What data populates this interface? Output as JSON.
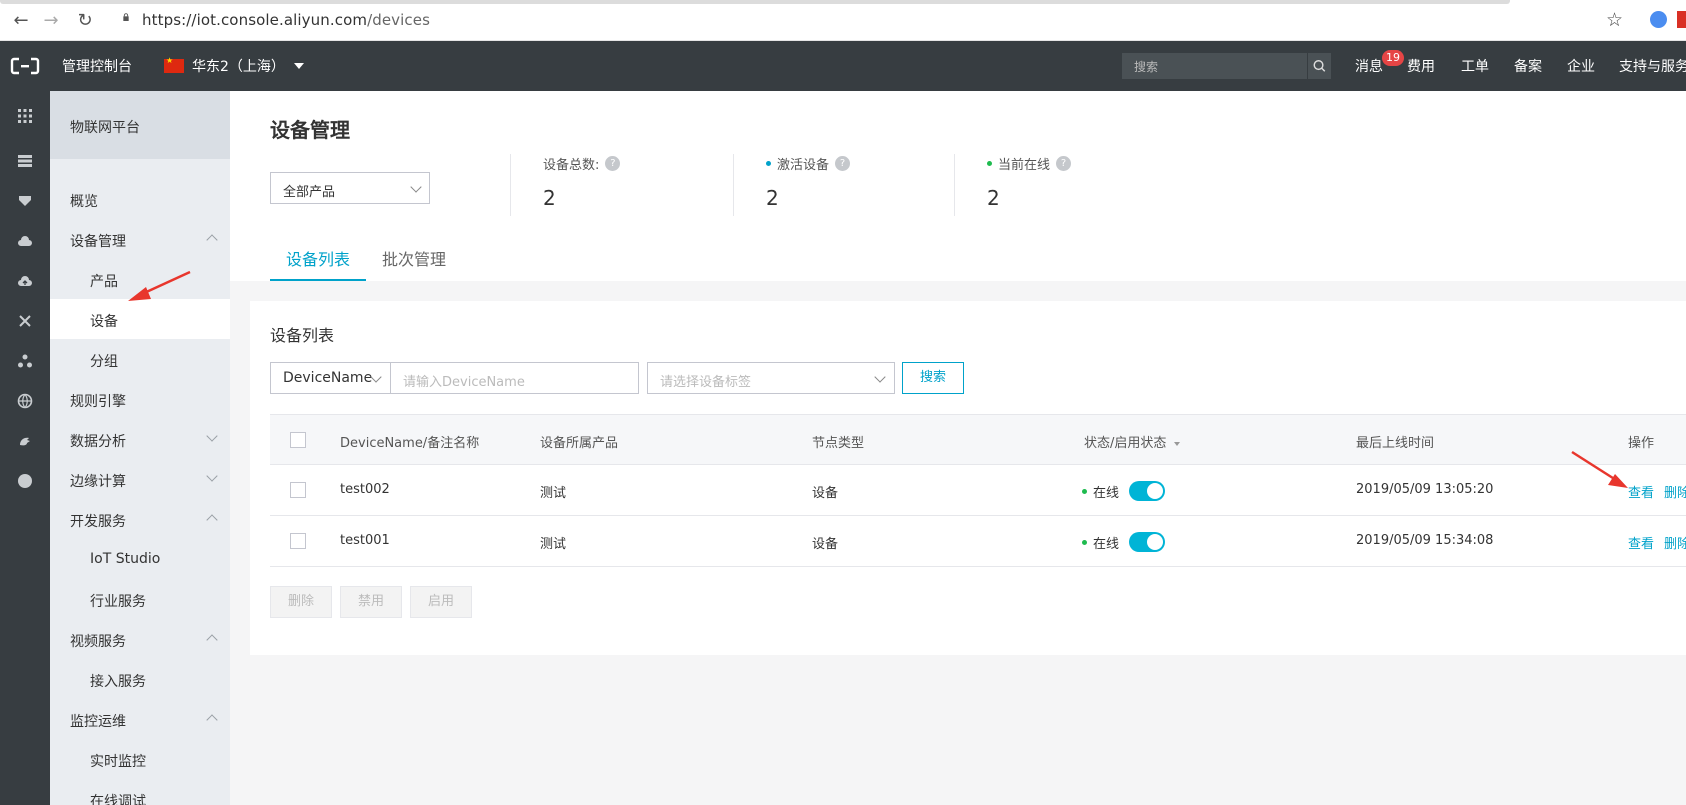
{
  "browser": {
    "url_base": "https://iot.console.aliyun.com",
    "url_path": "/devices"
  },
  "topnav": {
    "console_label": "管理控制台",
    "region": "华东2（上海）",
    "search_placeholder": "搜索",
    "links": [
      "消息",
      "费用",
      "工单",
      "备案",
      "企业",
      "支持与服务"
    ],
    "message_badge": "19"
  },
  "rail_icons": [
    "grid-icon",
    "storage-icon",
    "shield-icon",
    "cloud-icon",
    "cloud-up-icon",
    "network-icon",
    "cluster-icon",
    "globe-icon",
    "dragon-icon",
    "circle-icon"
  ],
  "sidebar": {
    "header": "物联网平台",
    "items": [
      {
        "label": "概览",
        "level": 0
      },
      {
        "label": "设备管理",
        "level": 0,
        "chevron": "up"
      },
      {
        "label": "产品",
        "level": 1
      },
      {
        "label": "设备",
        "level": 1,
        "active": true
      },
      {
        "label": "分组",
        "level": 1
      },
      {
        "label": "规则引擎",
        "level": 0
      },
      {
        "label": "数据分析",
        "level": 0,
        "chevron": "down"
      },
      {
        "label": "边缘计算",
        "level": 0,
        "chevron": "down"
      },
      {
        "label": "开发服务",
        "level": 0,
        "chevron": "up"
      },
      {
        "label": "IoT Studio",
        "level": 1
      },
      {
        "label": "行业服务",
        "level": 1
      },
      {
        "label": "视频服务",
        "level": 0,
        "chevron": "up"
      },
      {
        "label": "接入服务",
        "level": 1
      },
      {
        "label": "监控运维",
        "level": 0,
        "chevron": "up"
      },
      {
        "label": "实时监控",
        "level": 1
      },
      {
        "label": "在线调试",
        "level": 1
      }
    ]
  },
  "main": {
    "title": "设备管理",
    "product_select": "全部产品",
    "stats": {
      "total_label": "设备总数:",
      "total_value": "2",
      "active_label": "激活设备",
      "active_value": "2",
      "online_label": "当前在线",
      "online_value": "2"
    },
    "tabs": [
      "设备列表",
      "批次管理"
    ],
    "active_tab": 0
  },
  "device_list": {
    "title": "设备列表",
    "filter_select": "DeviceName",
    "filter_input_placeholder": "请输入DeviceName",
    "tag_select_placeholder": "请选择设备标签",
    "search_button": "搜索",
    "columns": [
      "DeviceName/备注名称",
      "设备所属产品",
      "节点类型",
      "状态/启用状态",
      "最后上线时间",
      "操作"
    ],
    "rows": [
      {
        "name": "test002",
        "product": "测试",
        "node_type": "设备",
        "status": "在线",
        "enabled": true,
        "last_online": "2019/05/09 13:05:20",
        "view": "查看",
        "delete": "删除"
      },
      {
        "name": "test001",
        "product": "测试",
        "node_type": "设备",
        "status": "在线",
        "enabled": true,
        "last_online": "2019/05/09 15:34:08",
        "view": "查看",
        "delete": "删除"
      }
    ],
    "bulk_buttons": [
      "删除",
      "禁用",
      "启用"
    ]
  },
  "colors": {
    "accent": "#00a2ca",
    "topbar": "#373d41",
    "online": "#1ebb4f",
    "annotation_arrow": "#e8362d"
  }
}
